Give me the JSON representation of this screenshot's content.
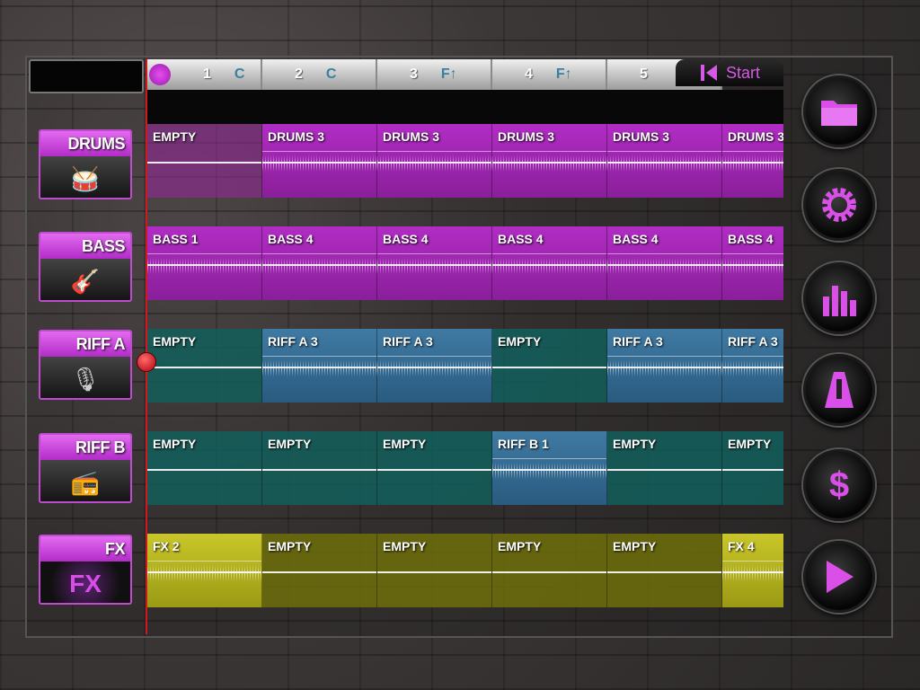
{
  "timeline": {
    "bars": [
      {
        "num": "1",
        "chord": "C"
      },
      {
        "num": "2",
        "chord": "C"
      },
      {
        "num": "3",
        "chord": "F↑"
      },
      {
        "num": "4",
        "chord": "F↑"
      },
      {
        "num": "5",
        "chord": ""
      }
    ],
    "start_label": "Start"
  },
  "tracks": [
    {
      "label": "DRUMS",
      "icon": "drums-kit-icon",
      "clips": [
        "EMPTY",
        "DRUMS 3",
        "DRUMS 3",
        "DRUMS 3",
        "DRUMS 3",
        "DRUMS 3"
      ]
    },
    {
      "label": "BASS",
      "icon": "bass-guitar-icon",
      "clips": [
        "BASS 1",
        "BASS 4",
        "BASS 4",
        "BASS 4",
        "BASS 4",
        "BASS 4"
      ]
    },
    {
      "label": "RIFF A",
      "icon": "instruments-icon",
      "clips": [
        "EMPTY",
        "RIFF A 3",
        "RIFF A 3",
        "EMPTY",
        "RIFF A 3",
        "RIFF A 3"
      ]
    },
    {
      "label": "RIFF B",
      "icon": "boombox-icon",
      "clips": [
        "EMPTY",
        "EMPTY",
        "EMPTY",
        "RIFF B 1",
        "EMPTY",
        "EMPTY"
      ]
    },
    {
      "label": "FX",
      "icon": "fx-icon",
      "fx_text": "FX",
      "clips": [
        "FX 2",
        "EMPTY",
        "EMPTY",
        "EMPTY",
        "EMPTY",
        "FX 4"
      ]
    }
  ],
  "side_buttons": [
    "folder-icon",
    "settings-gear-icon",
    "mixer-bars-icon",
    "metronome-icon",
    "dollar-icon",
    "play-icon"
  ],
  "colors": {
    "accent": "#d94fe8",
    "playhead": "#d01820",
    "drums": "#b12cc4",
    "riff_blue": "#3f7aa3",
    "teal": "#125f5c",
    "fx_yellow": "#c9c62a"
  }
}
